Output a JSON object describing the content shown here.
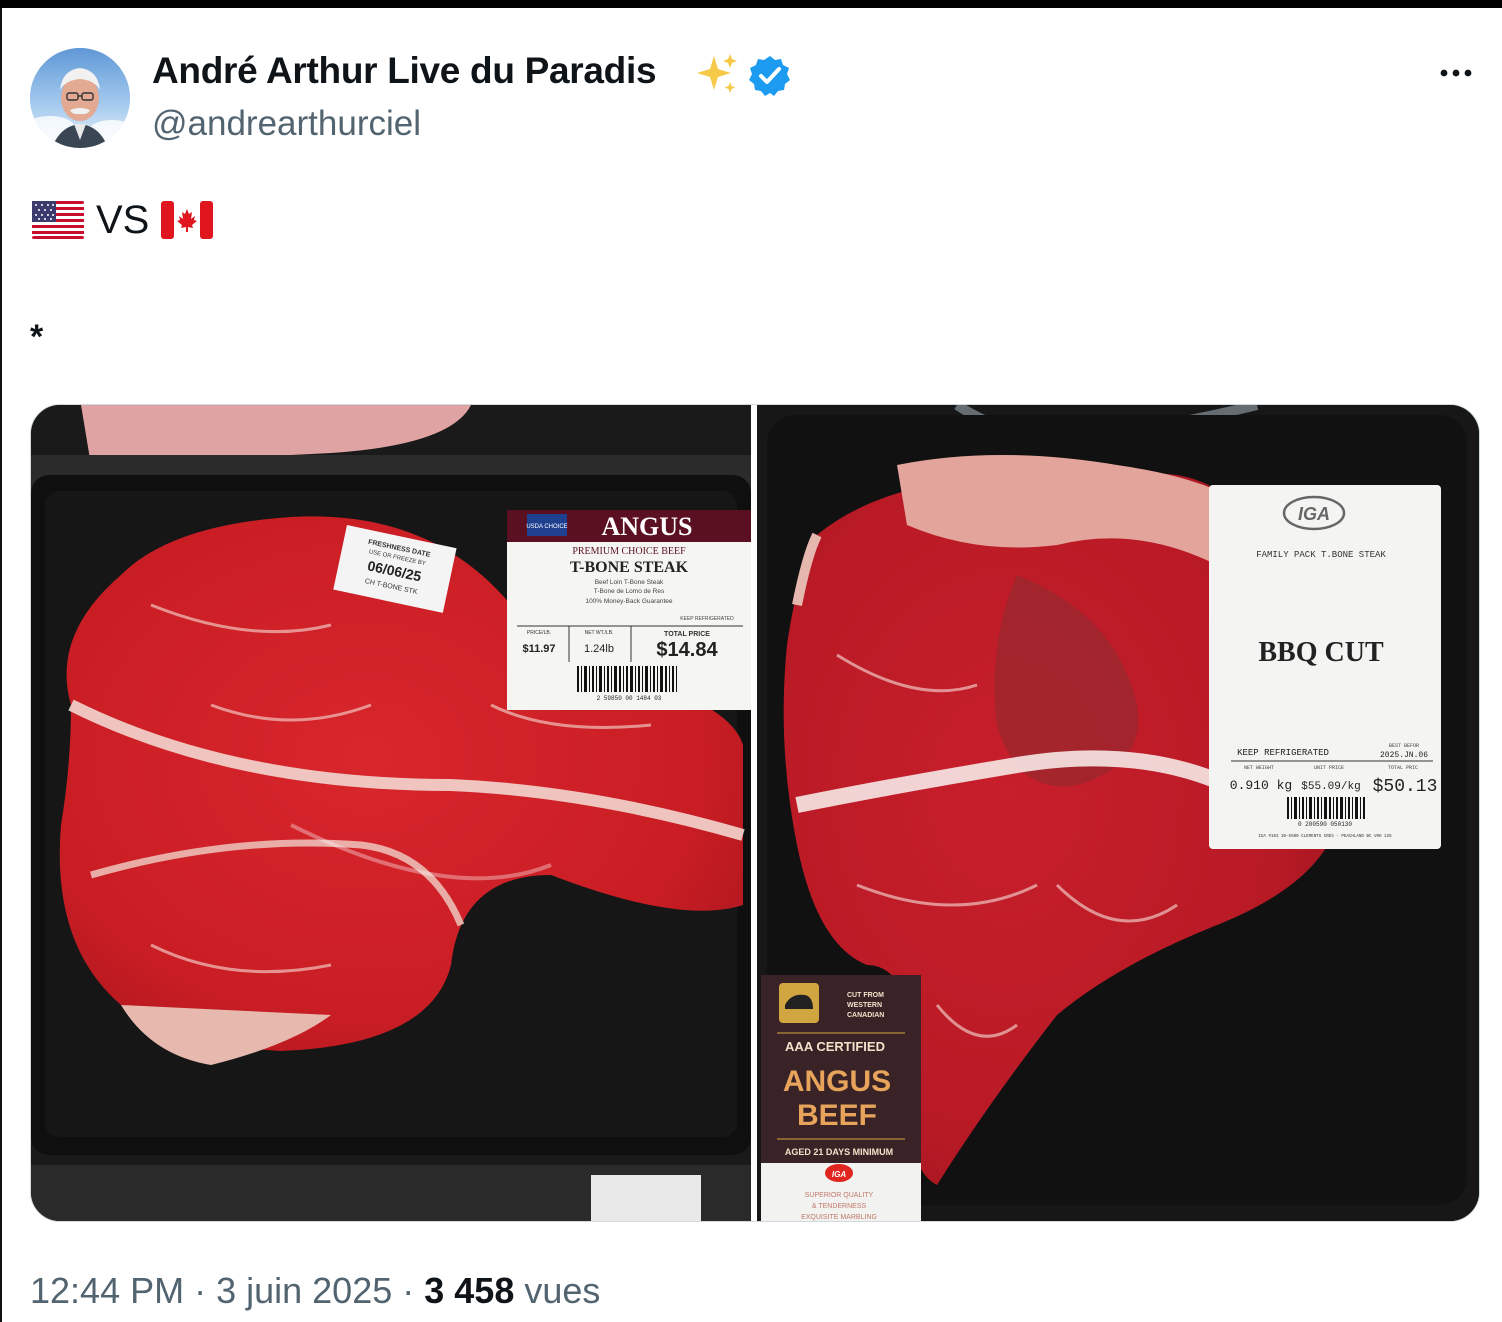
{
  "tweet": {
    "display_name": "André Arthur Live du Paradis",
    "handle": "@andrearthurciel",
    "text_vs": "VS",
    "text_asterisk": "*",
    "time": "12:44 PM",
    "sep1": " · ",
    "date": "3 juin 2025",
    "sep2": " · ",
    "views_count": "3 458",
    "views_label": " vues"
  },
  "left_photo": {
    "freshness_label": "FRESHNESS DATE",
    "freshness_sub": "USE OR FREEZE BY",
    "freshness_date": "06/06/25",
    "freshness_code": "CH T-BONE STK",
    "brand": "ANGUS",
    "usda": "USDA CHOICE",
    "brand_sub": "PREMIUM CHOICE BEEF",
    "product": "T-BONE STEAK",
    "line1": "Beef Loin T-Bone Steak",
    "line2": "T-Bone de Lomo de Res",
    "line3": "100% Money-Back Guarantee",
    "keep_refrigerated": "KEEP REFRIGERATED",
    "price_header": "PRICE/LB.",
    "weight_header": "NET WT./LB.",
    "total_header": "TOTAL PRICE",
    "price_per_lb": "$11.97",
    "net_weight": "1.24lb",
    "total_price": "$14.84",
    "barcode_number": "2 59850 00 1484 03"
  },
  "right_photo": {
    "store_logo": "IGA",
    "product": "FAMILY PACK T.BONE STEAK",
    "cut": "BBQ CUT",
    "keep_refrigerated": "KEEP REFRIGERATED",
    "best_before_header": "BEST BEFOR",
    "best_before": "2025.JN.06",
    "net_weight_header": "NET WEIGHT",
    "unit_price_header": "UNIT PRICE",
    "total_header": "TOTAL PRIC",
    "net_weight": "0.910 kg",
    "unit_price": "$55.09/kg",
    "total_price": "$50.13",
    "barcode_number": "0 200590 050130",
    "store_address": "IGA #103 30-5500 CLEMENTS CRES - PEACHLAND BC V0H 1X5",
    "badge_cut_from": "CUT FROM",
    "badge_western": "WESTERN",
    "badge_canadian": "CANADIAN",
    "badge_certified": "AAA CERTIFIED",
    "badge_angus": "ANGUS",
    "badge_beef": "BEEF",
    "badge_aged": "AGED 21 DAYS MINIMUM",
    "badge_iga": "IGA",
    "badge_quality": "SUPERIOR QUALITY",
    "badge_tenderness": "& TENDERNESS",
    "badge_marbling": "EXQUISITE MARBLING"
  },
  "icons": {
    "sparkles": "sparkles-icon",
    "verified": "verified-badge-icon",
    "more": "more-options-icon",
    "flag_us": "us-flag-icon",
    "flag_ca": "canada-flag-icon"
  },
  "colors": {
    "verified_blue": "#1d9bf0",
    "sparkle_yellow": "#f7c948",
    "secondary_text": "#536471"
  }
}
